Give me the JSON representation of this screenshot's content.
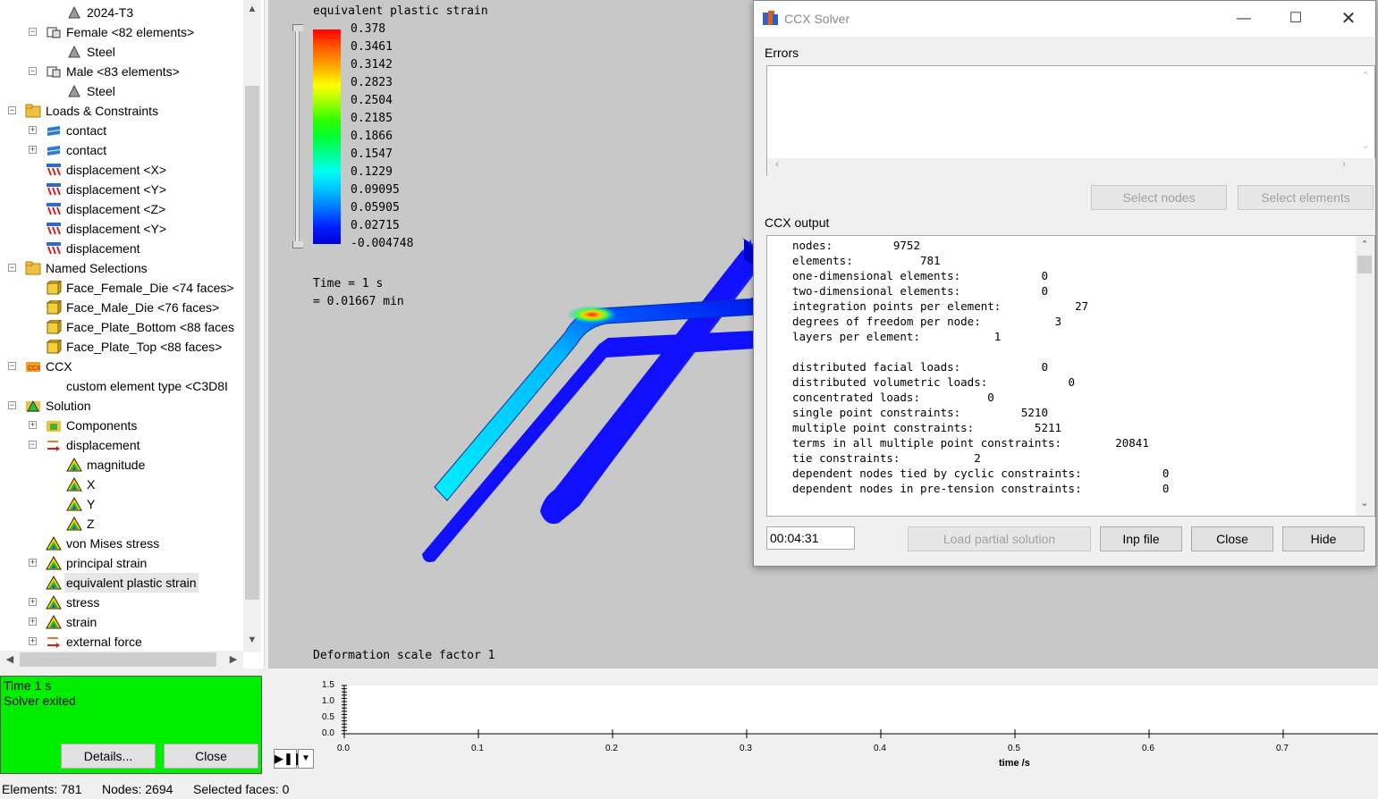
{
  "tree": {
    "items": [
      {
        "label": "2024-T3",
        "icon": "material-icon",
        "indent": 3,
        "expander": ""
      },
      {
        "label": "Female <82 elements>",
        "icon": "part-icon",
        "indent": 2,
        "expander": "-"
      },
      {
        "label": "Steel",
        "icon": "material-icon",
        "indent": 3,
        "expander": ""
      },
      {
        "label": "Male <83 elements>",
        "icon": "part-icon",
        "indent": 2,
        "expander": "-"
      },
      {
        "label": "Steel",
        "icon": "material-icon",
        "indent": 3,
        "expander": ""
      },
      {
        "label": "Loads & Constraints",
        "icon": "folder-icon",
        "indent": 1,
        "expander": "-"
      },
      {
        "label": "contact",
        "icon": "contact-icon",
        "indent": 2,
        "expander": "+"
      },
      {
        "label": "contact",
        "icon": "contact-icon",
        "indent": 2,
        "expander": "+"
      },
      {
        "label": "displacement <X>",
        "icon": "displacement-icon",
        "indent": 2,
        "expander": ""
      },
      {
        "label": "displacement <Y>",
        "icon": "displacement-icon",
        "indent": 2,
        "expander": ""
      },
      {
        "label": "displacement <Z>",
        "icon": "displacement-icon",
        "indent": 2,
        "expander": ""
      },
      {
        "label": "displacement <Y>",
        "icon": "displacement-icon",
        "indent": 2,
        "expander": ""
      },
      {
        "label": "displacement",
        "icon": "displacement-icon",
        "indent": 2,
        "expander": ""
      },
      {
        "label": "Named Selections",
        "icon": "folder-icon",
        "indent": 1,
        "expander": "-"
      },
      {
        "label": "Face_Female_Die <74 faces>",
        "icon": "selection-icon",
        "indent": 2,
        "expander": ""
      },
      {
        "label": "Face_Male_Die <76 faces>",
        "icon": "selection-icon",
        "indent": 2,
        "expander": ""
      },
      {
        "label": "Face_Plate_Bottom <88 faces",
        "icon": "selection-icon",
        "indent": 2,
        "expander": ""
      },
      {
        "label": "Face_Plate_Top <88 faces>",
        "icon": "selection-icon",
        "indent": 2,
        "expander": ""
      },
      {
        "label": "CCX",
        "icon": "ccx-icon",
        "indent": 1,
        "expander": "-"
      },
      {
        "label": "custom element type <C3D8I",
        "icon": "",
        "indent": 2,
        "expander": ""
      },
      {
        "label": "Solution",
        "icon": "solution-icon",
        "indent": 1,
        "expander": "-"
      },
      {
        "label": "Components",
        "icon": "components-icon",
        "indent": 2,
        "expander": "+"
      },
      {
        "label": "displacement",
        "icon": "vector-icon",
        "indent": 2,
        "expander": "-"
      },
      {
        "label": "magnitude",
        "icon": "result-icon",
        "indent": 3,
        "expander": ""
      },
      {
        "label": "X",
        "icon": "result-icon",
        "indent": 3,
        "expander": ""
      },
      {
        "label": "Y",
        "icon": "result-icon",
        "indent": 3,
        "expander": ""
      },
      {
        "label": "Z",
        "icon": "result-icon",
        "indent": 3,
        "expander": ""
      },
      {
        "label": "von Mises stress",
        "icon": "result-icon",
        "indent": 2,
        "expander": ""
      },
      {
        "label": "principal strain",
        "icon": "result-icon",
        "indent": 2,
        "expander": "+"
      },
      {
        "label": "equivalent plastic strain",
        "icon": "result-icon",
        "indent": 2,
        "expander": "",
        "selected": true
      },
      {
        "label": "stress",
        "icon": "result-icon",
        "indent": 2,
        "expander": "+"
      },
      {
        "label": "strain",
        "icon": "result-icon",
        "indent": 2,
        "expander": "+"
      },
      {
        "label": "external force",
        "icon": "vector-icon",
        "indent": 2,
        "expander": "+"
      }
    ]
  },
  "viewport": {
    "legend_title": "equivalent plastic strain",
    "legend_values": [
      "0.378",
      "0.3461",
      "0.3142",
      "0.2823",
      "0.2504",
      "0.2185",
      "0.1866",
      "0.1547",
      "0.1229",
      "0.09095",
      "0.05905",
      "0.02715",
      "-0.004748"
    ],
    "legend_colors": [
      "#ff0000",
      "#ff5000",
      "#ff9a00",
      "#ffe000",
      "#c8ff00",
      "#60ff00",
      "#00ff20",
      "#00ff90",
      "#00ffe8",
      "#00c8ff",
      "#0078ff",
      "#0030ff",
      "#0000e0"
    ],
    "time_line1": "Time = 1 s",
    "time_line2": "= 0.01667 min",
    "scale_text": "Deformation scale factor 1"
  },
  "dialog": {
    "title": "CCX Solver",
    "errors_label": "Errors",
    "select_nodes": "Select nodes",
    "select_elements": "Select elements",
    "output_label": "CCX output",
    "output_lines": [
      "nodes:         9752",
      "elements:          781",
      "one-dimensional elements:            0",
      "two-dimensional elements:            0",
      "integration points per element:           27",
      "degrees of freedom per node:           3",
      "layers per element:           1",
      "",
      "distributed facial loads:            0",
      "distributed volumetric loads:            0",
      "concentrated loads:          0",
      "single point constraints:         5210",
      "multiple point constraints:         5211",
      "terms in all multiple point constraints:        20841",
      "tie constraints:           2",
      "dependent nodes tied by cyclic constraints:            0",
      "dependent nodes in pre-tension constraints:            0"
    ],
    "elapsed": "00:04:31",
    "load_partial": "Load partial solution",
    "inp_file": "Inp file",
    "close": "Close",
    "hide": "Hide"
  },
  "status_panel": {
    "line1": "Time 1 s",
    "line2": "Solver exited",
    "details": "Details...",
    "close": "Close"
  },
  "timeline": {
    "y_ticks": [
      "1.5",
      "1.0",
      "0.5",
      "0.0"
    ],
    "x_ticks": [
      "0.0",
      "0.1",
      "0.2",
      "0.3",
      "0.4",
      "0.5",
      "0.6",
      "0.7"
    ],
    "x_label": "time /s"
  },
  "statusbar": {
    "elements": "Elements: 781",
    "nodes": "Nodes: 2694",
    "faces": "Selected faces: 0"
  }
}
